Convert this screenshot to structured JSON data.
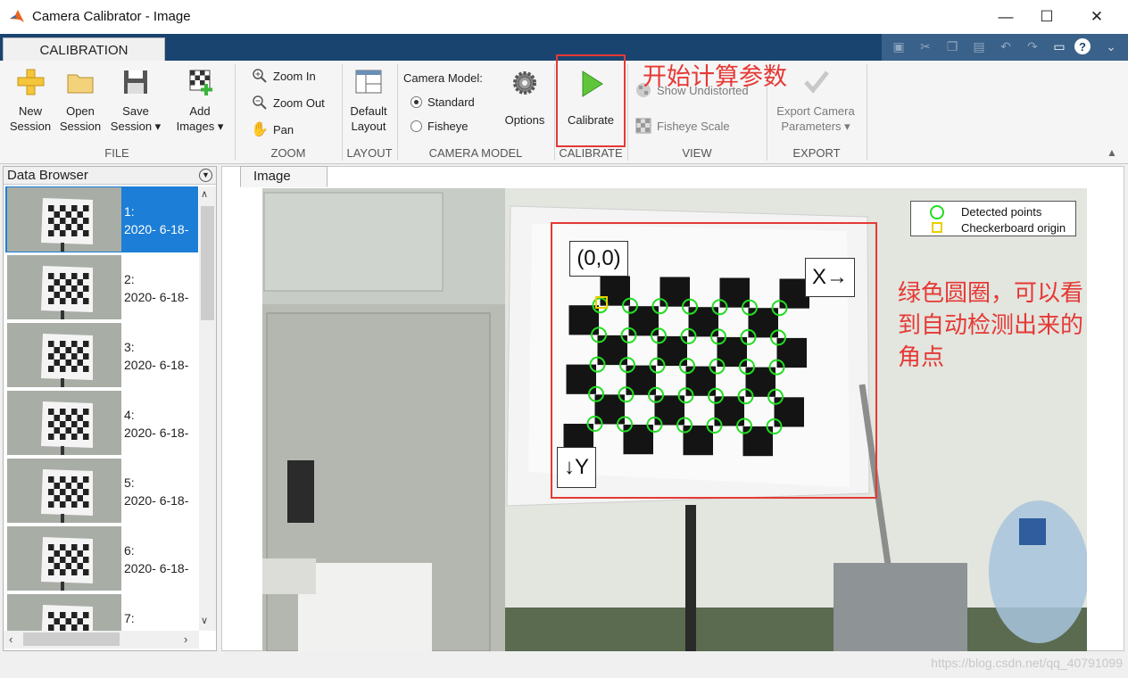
{
  "window": {
    "title": "Camera Calibrator - Image",
    "minimize": "—",
    "maximize": "☐",
    "close": "✕"
  },
  "ribbon_tabs": {
    "calibration": "CALIBRATION"
  },
  "ribbon": {
    "file": {
      "section": "FILE",
      "new_session": [
        "New",
        "Session"
      ],
      "open_session": [
        "Open",
        "Session"
      ],
      "save_session": [
        "Save",
        "Session ▾"
      ],
      "add_images": [
        "Add",
        "Images ▾"
      ]
    },
    "zoom": {
      "section": "ZOOM",
      "zoom_in": "Zoom In",
      "zoom_out": "Zoom Out",
      "pan": "Pan"
    },
    "layout": {
      "section": "LAYOUT",
      "default_layout": [
        "Default",
        "Layout"
      ]
    },
    "camera_model": {
      "section": "CAMERA MODEL",
      "label": "Camera Model:",
      "standard": "Standard",
      "fisheye": "Fisheye",
      "selected": "Standard",
      "options": "Options"
    },
    "calibrate": {
      "section": "CALIBRATE",
      "calibrate": "Calibrate"
    },
    "view": {
      "section": "VIEW",
      "show_undistorted": "Show Undistorted",
      "fisheye_scale": "Fisheye Scale"
    },
    "export": {
      "section": "EXPORT",
      "export_camera": [
        "Export Camera",
        "Parameters ▾"
      ]
    }
  },
  "annotations": {
    "calibrate_note": "开始计算参数",
    "detect_note": [
      "绿色圆圈，可以看",
      "到自动检测出来的",
      "角点"
    ]
  },
  "data_browser": {
    "title": "Data Browser",
    "items": [
      {
        "index": "1:",
        "date": "2020- 6-18-"
      },
      {
        "index": "2:",
        "date": "2020- 6-18-"
      },
      {
        "index": "3:",
        "date": "2020- 6-18-"
      },
      {
        "index": "4:",
        "date": "2020- 6-18-"
      },
      {
        "index": "5:",
        "date": "2020- 6-18-"
      },
      {
        "index": "6:",
        "date": "2020- 6-18-"
      },
      {
        "index": "7:",
        "date": ""
      }
    ],
    "selected_index": 1
  },
  "image_panel": {
    "tab": "Image",
    "legend": {
      "detected": "Detected points",
      "origin": "Checkerboard origin"
    },
    "origin_label": "(0,0)",
    "x_label": "X→",
    "y_label": "↓Y",
    "detected_color": "#22dd22",
    "origin_color": "#e8d000"
  },
  "status": {
    "watermark": "https://blog.csdn.net/qq_40791099"
  }
}
